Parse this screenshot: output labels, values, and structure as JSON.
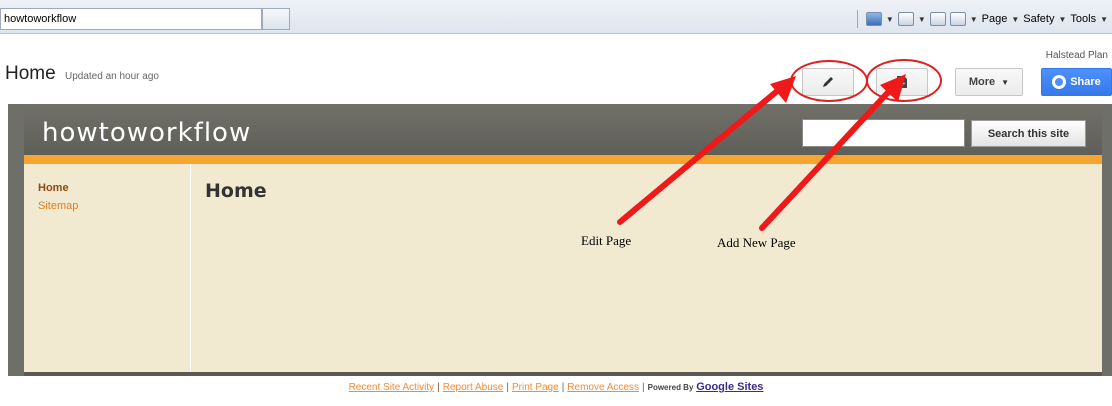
{
  "browser": {
    "tab_title": "howtoworkflow",
    "menus": [
      "Page",
      "Safety",
      "Tools"
    ]
  },
  "header": {
    "user": "Halstead Plan",
    "page_title": "Home",
    "updated": "Updated an hour ago",
    "more_label": "More",
    "share_label": "Share",
    "edit_icon": "pencil-icon",
    "add_icon": "new-page-icon"
  },
  "site": {
    "name": "howtoworkflow",
    "search_placeholder": "",
    "search_button": "Search this site",
    "nav": [
      "Home",
      "Sitemap"
    ],
    "content_title": "Home"
  },
  "annotations": {
    "edit_label": "Edit Page",
    "add_label": "Add New Page",
    "color": "#e02020"
  },
  "footer": {
    "links": [
      "Recent Site Activity",
      "Report Abuse",
      "Print Page",
      "Remove Access"
    ],
    "powered": "Powered By",
    "brand": "Google Sites"
  },
  "colors": {
    "accent_orange": "#f7a531",
    "content_bg": "#f2ead0",
    "header_bg": "#6b6b64",
    "share_blue": "#4d90fe"
  }
}
